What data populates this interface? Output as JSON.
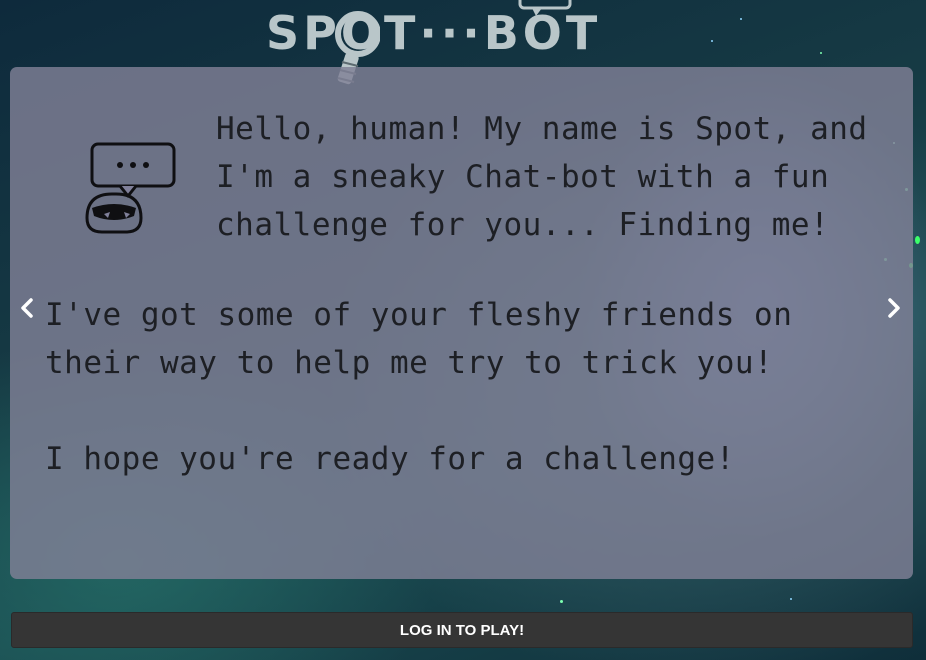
{
  "logo": {
    "text": "SPOT···BOT"
  },
  "intro": {
    "greeting": "Hello, human! My name is Spot, and I'm a sneaky Chat-bot with a fun challenge for you... Finding me!",
    "paragraph_1": "I've got some of your fleshy friends on their way to help me try to trick you!",
    "paragraph_2": "I hope you're ready for a challenge!"
  },
  "icons": {
    "bot": "chat-bot-icon",
    "prev": "chevron-left-icon",
    "next": "chevron-right-icon",
    "magnifier": "magnifier-icon"
  },
  "login": {
    "label": "LOG IN TO PLAY!"
  },
  "colors": {
    "card_bg": "#80809a",
    "text": "#1d1f24",
    "logo": "#b9c6c9",
    "button_bg": "#353535"
  }
}
